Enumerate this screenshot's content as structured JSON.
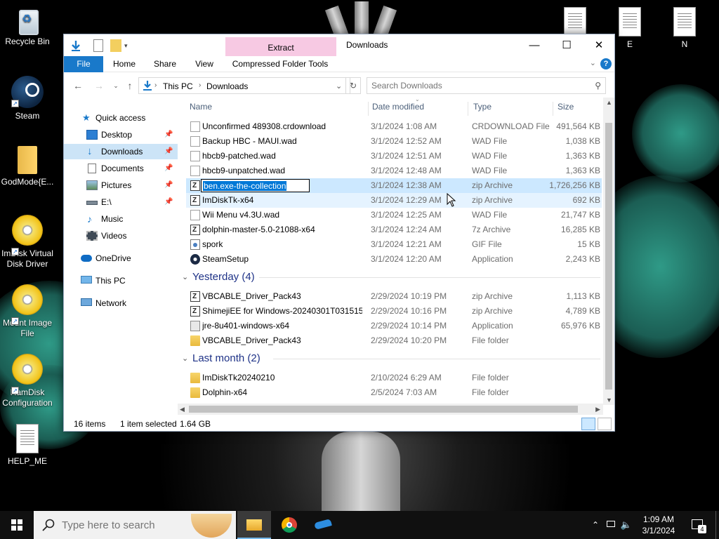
{
  "desktop": {
    "icons_left": [
      {
        "label": "Recycle Bin"
      },
      {
        "label": "Steam"
      },
      {
        "label": "GodMode{E..."
      },
      {
        "label": "ImDisk Virtual Disk Driver"
      },
      {
        "label": "Mount Image File"
      },
      {
        "label": "RamDisk Configuration"
      },
      {
        "label": "HELP_ME"
      }
    ],
    "icons_top_right": [
      {
        "label": ""
      },
      {
        "label": "E"
      },
      {
        "label": "N"
      }
    ]
  },
  "window": {
    "title": "Downloads",
    "contextual_tab": "Extract",
    "ribbon_tabs": [
      "File",
      "Home",
      "Share",
      "View",
      "Compressed Folder Tools"
    ],
    "help_label": "?",
    "address": {
      "root": "This PC",
      "current": "Downloads"
    },
    "search_placeholder": "Search Downloads",
    "columns": {
      "name": "Name",
      "date": "Date modified",
      "type": "Type",
      "size": "Size"
    },
    "nav": [
      {
        "label": "Quick access"
      },
      {
        "label": "Desktop"
      },
      {
        "label": "Downloads"
      },
      {
        "label": "Documents"
      },
      {
        "label": "Pictures"
      },
      {
        "label": "E:\\"
      },
      {
        "label": "Music"
      },
      {
        "label": "Videos"
      },
      {
        "label": "OneDrive"
      },
      {
        "label": "This PC"
      },
      {
        "label": "Network"
      }
    ],
    "today_files": [
      {
        "name": "Unconfirmed 489308.crdownload",
        "date": "3/1/2024 1:08 AM",
        "type": "CRDOWNLOAD File",
        "size": "491,564 KB"
      },
      {
        "name": "Backup HBC - MAUI.wad",
        "date": "3/1/2024 12:52 AM",
        "type": "WAD File",
        "size": "1,038 KB"
      },
      {
        "name": "hbcb9-patched.wad",
        "date": "3/1/2024 12:51 AM",
        "type": "WAD File",
        "size": "1,363 KB"
      },
      {
        "name": "hbcb9-unpatched.wad",
        "date": "3/1/2024 12:48 AM",
        "type": "WAD File",
        "size": "1,363 KB"
      },
      {
        "name": "ben.exe-the-collection",
        "date": "3/1/2024 12:38 AM",
        "type": "zip Archive",
        "size": "1,726,256 KB"
      },
      {
        "name": "ImDiskTk-x64",
        "date": "3/1/2024 12:29 AM",
        "type": "zip Archive",
        "size": "692 KB"
      },
      {
        "name": "Wii Menu v4.3U.wad",
        "date": "3/1/2024 12:25 AM",
        "type": "WAD File",
        "size": "21,747 KB"
      },
      {
        "name": "dolphin-master-5.0-21088-x64",
        "date": "3/1/2024 12:24 AM",
        "type": "7z Archive",
        "size": "16,285 KB"
      },
      {
        "name": "spork",
        "date": "3/1/2024 12:21 AM",
        "type": "GIF File",
        "size": "15 KB"
      },
      {
        "name": "SteamSetup",
        "date": "3/1/2024 12:20 AM",
        "type": "Application",
        "size": "2,243 KB"
      }
    ],
    "group_yesterday": "Yesterday (4)",
    "yesterday_files": [
      {
        "name": "VBCABLE_Driver_Pack43",
        "date": "2/29/2024 10:19 PM",
        "type": "zip Archive",
        "size": "1,113 KB"
      },
      {
        "name": "ShimejiEE for Windows-20240301T031515...",
        "date": "2/29/2024 10:16 PM",
        "type": "zip Archive",
        "size": "4,789 KB"
      },
      {
        "name": "jre-8u401-windows-x64",
        "date": "2/29/2024 10:14 PM",
        "type": "Application",
        "size": "65,976 KB"
      },
      {
        "name": "VBCABLE_Driver_Pack43",
        "date": "2/29/2024 10:20 PM",
        "type": "File folder",
        "size": ""
      }
    ],
    "group_last_month": "Last month (2)",
    "last_month_files": [
      {
        "name": "ImDiskTk20240210",
        "date": "2/10/2024 6:29 AM",
        "type": "File folder",
        "size": ""
      },
      {
        "name": "Dolphin-x64",
        "date": "2/5/2024 7:03 AM",
        "type": "File folder",
        "size": ""
      }
    ],
    "status": {
      "count": "16 items",
      "selected": "1 item selected",
      "size": "1.64 GB"
    }
  },
  "taskbar": {
    "search_placeholder": "Type here to search",
    "time": "1:09 AM",
    "date": "3/1/2024",
    "notification_count": "4"
  }
}
